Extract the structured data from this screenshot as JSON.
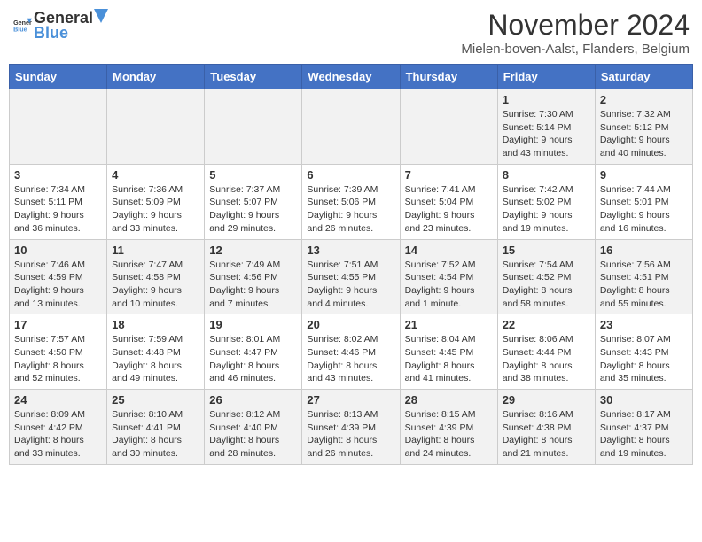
{
  "logo": {
    "text_general": "General",
    "text_blue": "Blue"
  },
  "title": "November 2024",
  "subtitle": "Mielen-boven-Aalst, Flanders, Belgium",
  "days_of_week": [
    "Sunday",
    "Monday",
    "Tuesday",
    "Wednesday",
    "Thursday",
    "Friday",
    "Saturday"
  ],
  "weeks": [
    [
      {
        "day": "",
        "info": ""
      },
      {
        "day": "",
        "info": ""
      },
      {
        "day": "",
        "info": ""
      },
      {
        "day": "",
        "info": ""
      },
      {
        "day": "",
        "info": ""
      },
      {
        "day": "1",
        "info": "Sunrise: 7:30 AM\nSunset: 5:14 PM\nDaylight: 9 hours and 43 minutes."
      },
      {
        "day": "2",
        "info": "Sunrise: 7:32 AM\nSunset: 5:12 PM\nDaylight: 9 hours and 40 minutes."
      }
    ],
    [
      {
        "day": "3",
        "info": "Sunrise: 7:34 AM\nSunset: 5:11 PM\nDaylight: 9 hours and 36 minutes."
      },
      {
        "day": "4",
        "info": "Sunrise: 7:36 AM\nSunset: 5:09 PM\nDaylight: 9 hours and 33 minutes."
      },
      {
        "day": "5",
        "info": "Sunrise: 7:37 AM\nSunset: 5:07 PM\nDaylight: 9 hours and 29 minutes."
      },
      {
        "day": "6",
        "info": "Sunrise: 7:39 AM\nSunset: 5:06 PM\nDaylight: 9 hours and 26 minutes."
      },
      {
        "day": "7",
        "info": "Sunrise: 7:41 AM\nSunset: 5:04 PM\nDaylight: 9 hours and 23 minutes."
      },
      {
        "day": "8",
        "info": "Sunrise: 7:42 AM\nSunset: 5:02 PM\nDaylight: 9 hours and 19 minutes."
      },
      {
        "day": "9",
        "info": "Sunrise: 7:44 AM\nSunset: 5:01 PM\nDaylight: 9 hours and 16 minutes."
      }
    ],
    [
      {
        "day": "10",
        "info": "Sunrise: 7:46 AM\nSunset: 4:59 PM\nDaylight: 9 hours and 13 minutes."
      },
      {
        "day": "11",
        "info": "Sunrise: 7:47 AM\nSunset: 4:58 PM\nDaylight: 9 hours and 10 minutes."
      },
      {
        "day": "12",
        "info": "Sunrise: 7:49 AM\nSunset: 4:56 PM\nDaylight: 9 hours and 7 minutes."
      },
      {
        "day": "13",
        "info": "Sunrise: 7:51 AM\nSunset: 4:55 PM\nDaylight: 9 hours and 4 minutes."
      },
      {
        "day": "14",
        "info": "Sunrise: 7:52 AM\nSunset: 4:54 PM\nDaylight: 9 hours and 1 minute."
      },
      {
        "day": "15",
        "info": "Sunrise: 7:54 AM\nSunset: 4:52 PM\nDaylight: 8 hours and 58 minutes."
      },
      {
        "day": "16",
        "info": "Sunrise: 7:56 AM\nSunset: 4:51 PM\nDaylight: 8 hours and 55 minutes."
      }
    ],
    [
      {
        "day": "17",
        "info": "Sunrise: 7:57 AM\nSunset: 4:50 PM\nDaylight: 8 hours and 52 minutes."
      },
      {
        "day": "18",
        "info": "Sunrise: 7:59 AM\nSunset: 4:48 PM\nDaylight: 8 hours and 49 minutes."
      },
      {
        "day": "19",
        "info": "Sunrise: 8:01 AM\nSunset: 4:47 PM\nDaylight: 8 hours and 46 minutes."
      },
      {
        "day": "20",
        "info": "Sunrise: 8:02 AM\nSunset: 4:46 PM\nDaylight: 8 hours and 43 minutes."
      },
      {
        "day": "21",
        "info": "Sunrise: 8:04 AM\nSunset: 4:45 PM\nDaylight: 8 hours and 41 minutes."
      },
      {
        "day": "22",
        "info": "Sunrise: 8:06 AM\nSunset: 4:44 PM\nDaylight: 8 hours and 38 minutes."
      },
      {
        "day": "23",
        "info": "Sunrise: 8:07 AM\nSunset: 4:43 PM\nDaylight: 8 hours and 35 minutes."
      }
    ],
    [
      {
        "day": "24",
        "info": "Sunrise: 8:09 AM\nSunset: 4:42 PM\nDaylight: 8 hours and 33 minutes."
      },
      {
        "day": "25",
        "info": "Sunrise: 8:10 AM\nSunset: 4:41 PM\nDaylight: 8 hours and 30 minutes."
      },
      {
        "day": "26",
        "info": "Sunrise: 8:12 AM\nSunset: 4:40 PM\nDaylight: 8 hours and 28 minutes."
      },
      {
        "day": "27",
        "info": "Sunrise: 8:13 AM\nSunset: 4:39 PM\nDaylight: 8 hours and 26 minutes."
      },
      {
        "day": "28",
        "info": "Sunrise: 8:15 AM\nSunset: 4:39 PM\nDaylight: 8 hours and 24 minutes."
      },
      {
        "day": "29",
        "info": "Sunrise: 8:16 AM\nSunset: 4:38 PM\nDaylight: 8 hours and 21 minutes."
      },
      {
        "day": "30",
        "info": "Sunrise: 8:17 AM\nSunset: 4:37 PM\nDaylight: 8 hours and 19 minutes."
      }
    ]
  ]
}
